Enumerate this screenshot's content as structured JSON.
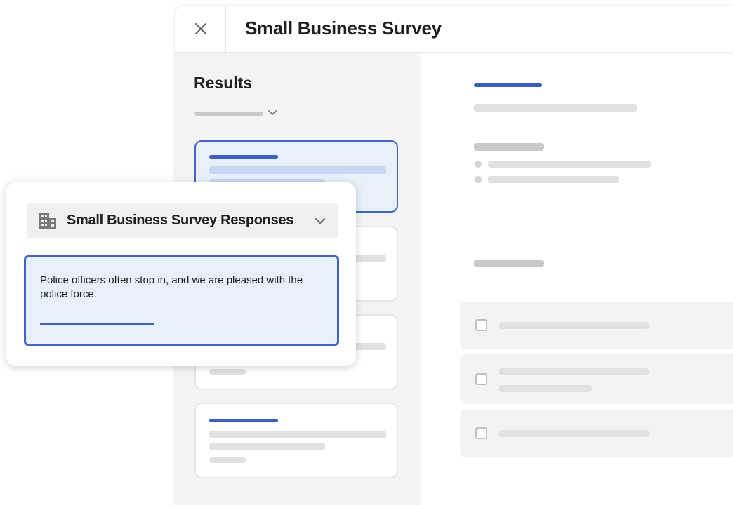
{
  "window": {
    "title": "Small Business Survey",
    "close_icon": "close-icon"
  },
  "left_panel": {
    "heading": "Results",
    "filter_icon": "chevron-down-icon"
  },
  "popup": {
    "dropdown": {
      "icon": "building-icon",
      "label": "Small Business Survey Responses",
      "chevron_icon": "chevron-down-icon"
    },
    "quote": {
      "text": "Police officers often stop in, and we are pleased with the police force."
    }
  },
  "colors": {
    "accent": "#3a5fc1",
    "selected_bg": "#e8f0fc",
    "panel_bg": "#f4f4f5"
  }
}
